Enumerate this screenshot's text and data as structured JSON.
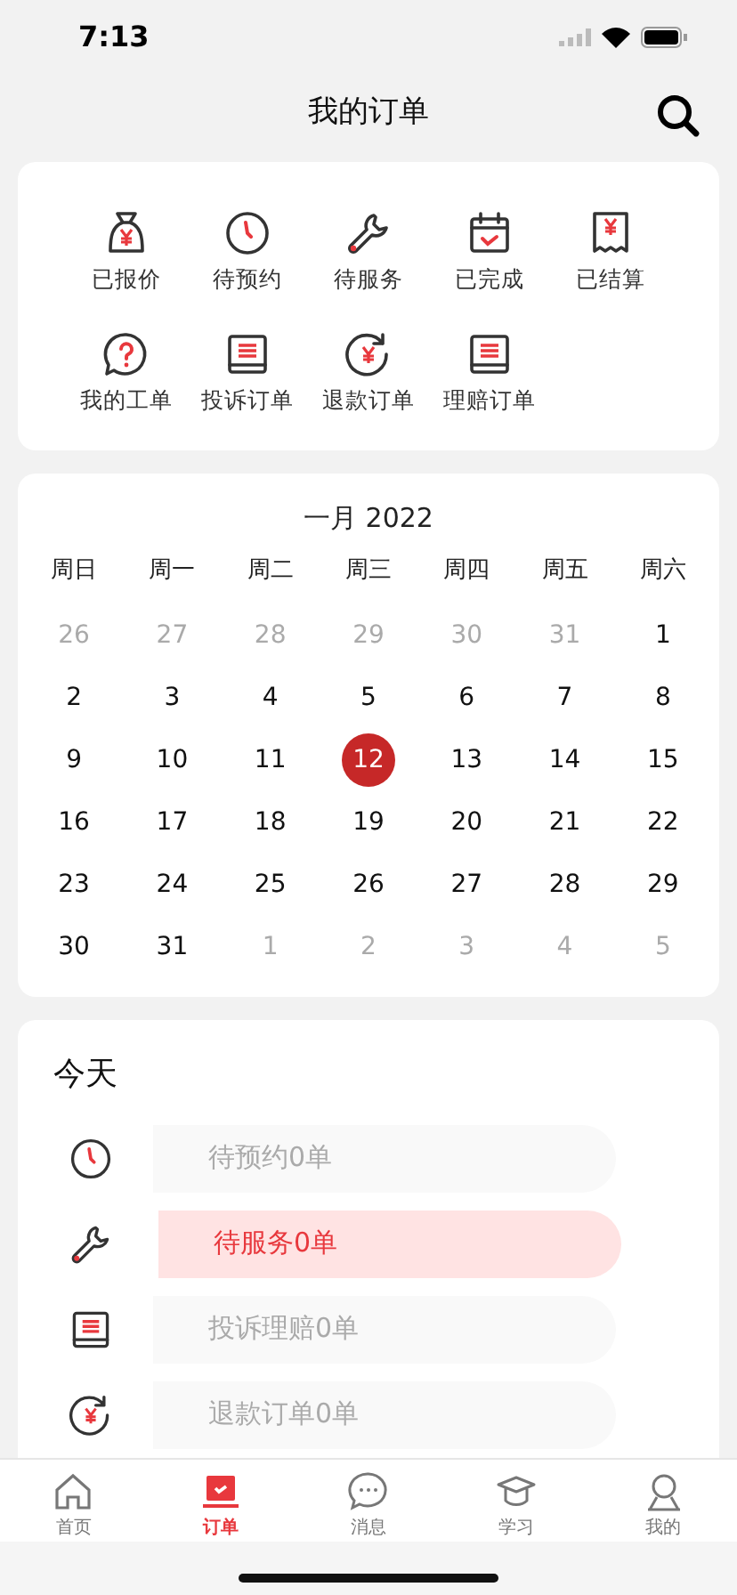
{
  "status_bar": {
    "time": "7:13"
  },
  "header": {
    "title": "我的订单"
  },
  "order_types": [
    {
      "label": "已报价"
    },
    {
      "label": "待预约"
    },
    {
      "label": "待服务"
    },
    {
      "label": "已完成"
    },
    {
      "label": "已结算"
    },
    {
      "label": "我的工单"
    },
    {
      "label": "投诉订单"
    },
    {
      "label": "退款订单"
    },
    {
      "label": "理赔订单"
    }
  ],
  "calendar": {
    "title": "一月 2022",
    "weekdays": [
      "周日",
      "周一",
      "周二",
      "周三",
      "周四",
      "周五",
      "周六"
    ],
    "weeks": [
      [
        {
          "day": "26",
          "muted": true,
          "selected": false
        },
        {
          "day": "27",
          "muted": true,
          "selected": false
        },
        {
          "day": "28",
          "muted": true,
          "selected": false
        },
        {
          "day": "29",
          "muted": true,
          "selected": false
        },
        {
          "day": "30",
          "muted": true,
          "selected": false
        },
        {
          "day": "31",
          "muted": true,
          "selected": false
        },
        {
          "day": "1",
          "muted": false,
          "selected": false
        }
      ],
      [
        {
          "day": "2",
          "muted": false,
          "selected": false
        },
        {
          "day": "3",
          "muted": false,
          "selected": false
        },
        {
          "day": "4",
          "muted": false,
          "selected": false
        },
        {
          "day": "5",
          "muted": false,
          "selected": false
        },
        {
          "day": "6",
          "muted": false,
          "selected": false
        },
        {
          "day": "7",
          "muted": false,
          "selected": false
        },
        {
          "day": "8",
          "muted": false,
          "selected": false
        }
      ],
      [
        {
          "day": "9",
          "muted": false,
          "selected": false
        },
        {
          "day": "10",
          "muted": false,
          "selected": false
        },
        {
          "day": "11",
          "muted": false,
          "selected": false
        },
        {
          "day": "12",
          "muted": false,
          "selected": true
        },
        {
          "day": "13",
          "muted": false,
          "selected": false
        },
        {
          "day": "14",
          "muted": false,
          "selected": false
        },
        {
          "day": "15",
          "muted": false,
          "selected": false
        }
      ],
      [
        {
          "day": "16",
          "muted": false,
          "selected": false
        },
        {
          "day": "17",
          "muted": false,
          "selected": false
        },
        {
          "day": "18",
          "muted": false,
          "selected": false
        },
        {
          "day": "19",
          "muted": false,
          "selected": false
        },
        {
          "day": "20",
          "muted": false,
          "selected": false
        },
        {
          "day": "21",
          "muted": false,
          "selected": false
        },
        {
          "day": "22",
          "muted": false,
          "selected": false
        }
      ],
      [
        {
          "day": "23",
          "muted": false,
          "selected": false
        },
        {
          "day": "24",
          "muted": false,
          "selected": false
        },
        {
          "day": "25",
          "muted": false,
          "selected": false
        },
        {
          "day": "26",
          "muted": false,
          "selected": false
        },
        {
          "day": "27",
          "muted": false,
          "selected": false
        },
        {
          "day": "28",
          "muted": false,
          "selected": false
        },
        {
          "day": "29",
          "muted": false,
          "selected": false
        }
      ],
      [
        {
          "day": "30",
          "muted": false,
          "selected": false
        },
        {
          "day": "31",
          "muted": false,
          "selected": false
        },
        {
          "day": "1",
          "muted": true,
          "selected": false
        },
        {
          "day": "2",
          "muted": true,
          "selected": false
        },
        {
          "day": "3",
          "muted": true,
          "selected": false
        },
        {
          "day": "4",
          "muted": true,
          "selected": false
        },
        {
          "day": "5",
          "muted": true,
          "selected": false
        }
      ]
    ]
  },
  "today": {
    "title": "今天",
    "items": [
      {
        "label": "待预约0单",
        "selected": false
      },
      {
        "label": "待服务0单",
        "selected": true
      },
      {
        "label": "投诉理赔0单",
        "selected": false
      },
      {
        "label": "退款订单0单",
        "selected": false
      }
    ]
  },
  "tab_bar": [
    {
      "label": "首页",
      "selected": false
    },
    {
      "label": "订单",
      "selected": true
    },
    {
      "label": "消息",
      "selected": false
    },
    {
      "label": "学习",
      "selected": false
    },
    {
      "label": "我的",
      "selected": false
    }
  ]
}
